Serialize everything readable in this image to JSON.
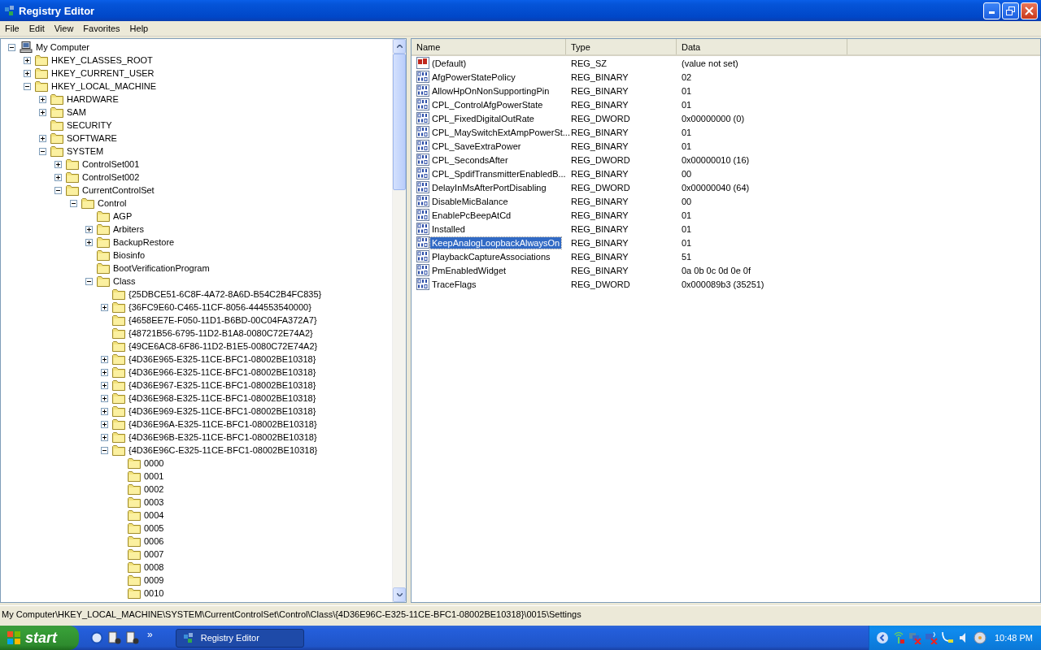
{
  "window": {
    "title": "Registry Editor"
  },
  "menu": [
    "File",
    "Edit",
    "View",
    "Favorites",
    "Help"
  ],
  "tree": [
    {
      "label": "My Computer",
      "kind": "computer",
      "expanded": true,
      "children": [
        {
          "label": "HKEY_CLASSES_ROOT",
          "expanded": false
        },
        {
          "label": "HKEY_CURRENT_USER",
          "expanded": false
        },
        {
          "label": "HKEY_LOCAL_MACHINE",
          "expanded": true,
          "children": [
            {
              "label": "HARDWARE",
              "expanded": false
            },
            {
              "label": "SAM",
              "expanded": false
            },
            {
              "label": "SECURITY"
            },
            {
              "label": "SOFTWARE",
              "expanded": false
            },
            {
              "label": "SYSTEM",
              "expanded": true,
              "children": [
                {
                  "label": "ControlSet001",
                  "expanded": false
                },
                {
                  "label": "ControlSet002",
                  "expanded": false
                },
                {
                  "label": "CurrentControlSet",
                  "expanded": true,
                  "children": [
                    {
                      "label": "Control",
                      "expanded": true,
                      "children": [
                        {
                          "label": "AGP"
                        },
                        {
                          "label": "Arbiters",
                          "expanded": false
                        },
                        {
                          "label": "BackupRestore",
                          "expanded": false
                        },
                        {
                          "label": "Biosinfo"
                        },
                        {
                          "label": "BootVerificationProgram"
                        },
                        {
                          "label": "Class",
                          "expanded": true,
                          "children": [
                            {
                              "label": "{25DBCE51-6C8F-4A72-8A6D-B54C2B4FC835}"
                            },
                            {
                              "label": "{36FC9E60-C465-11CF-8056-444553540000}",
                              "expanded": false
                            },
                            {
                              "label": "{4658EE7E-F050-11D1-B6BD-00C04FA372A7}"
                            },
                            {
                              "label": "{48721B56-6795-11D2-B1A8-0080C72E74A2}"
                            },
                            {
                              "label": "{49CE6AC8-6F86-11D2-B1E5-0080C72E74A2}"
                            },
                            {
                              "label": "{4D36E965-E325-11CE-BFC1-08002BE10318}",
                              "expanded": false
                            },
                            {
                              "label": "{4D36E966-E325-11CE-BFC1-08002BE10318}",
                              "expanded": false
                            },
                            {
                              "label": "{4D36E967-E325-11CE-BFC1-08002BE10318}",
                              "expanded": false
                            },
                            {
                              "label": "{4D36E968-E325-11CE-BFC1-08002BE10318}",
                              "expanded": false
                            },
                            {
                              "label": "{4D36E969-E325-11CE-BFC1-08002BE10318}",
                              "expanded": false
                            },
                            {
                              "label": "{4D36E96A-E325-11CE-BFC1-08002BE10318}",
                              "expanded": false
                            },
                            {
                              "label": "{4D36E96B-E325-11CE-BFC1-08002BE10318}",
                              "expanded": false
                            },
                            {
                              "label": "{4D36E96C-E325-11CE-BFC1-08002BE10318}",
                              "expanded": true,
                              "children": [
                                {
                                  "label": "0000"
                                },
                                {
                                  "label": "0001"
                                },
                                {
                                  "label": "0002"
                                },
                                {
                                  "label": "0003"
                                },
                                {
                                  "label": "0004"
                                },
                                {
                                  "label": "0005"
                                },
                                {
                                  "label": "0006"
                                },
                                {
                                  "label": "0007"
                                },
                                {
                                  "label": "0008"
                                },
                                {
                                  "label": "0009"
                                },
                                {
                                  "label": "0010"
                                }
                              ]
                            }
                          ]
                        }
                      ]
                    }
                  ]
                }
              ]
            }
          ]
        }
      ]
    }
  ],
  "values": {
    "columns": [
      "Name",
      "Type",
      "Data"
    ],
    "rows": [
      {
        "name": "(Default)",
        "type": "REG_SZ",
        "data": "(value not set)",
        "kind": "string",
        "selected": false
      },
      {
        "name": "AfgPowerStatePolicy",
        "type": "REG_BINARY",
        "data": "02",
        "kind": "binary",
        "selected": false
      },
      {
        "name": "AllowHpOnNonSupportingPin",
        "type": "REG_BINARY",
        "data": "01",
        "kind": "binary",
        "selected": false
      },
      {
        "name": "CPL_ControlAfgPowerState",
        "type": "REG_BINARY",
        "data": "01",
        "kind": "binary",
        "selected": false
      },
      {
        "name": "CPL_FixedDigitalOutRate",
        "type": "REG_DWORD",
        "data": "0x00000000 (0)",
        "kind": "binary",
        "selected": false
      },
      {
        "name": "CPL_MaySwitchExtAmpPowerSt...",
        "type": "REG_BINARY",
        "data": "01",
        "kind": "binary",
        "selected": false
      },
      {
        "name": "CPL_SaveExtraPower",
        "type": "REG_BINARY",
        "data": "01",
        "kind": "binary",
        "selected": false
      },
      {
        "name": "CPL_SecondsAfter",
        "type": "REG_DWORD",
        "data": "0x00000010 (16)",
        "kind": "binary",
        "selected": false
      },
      {
        "name": "CPL_SpdifTransmitterEnabledB...",
        "type": "REG_BINARY",
        "data": "00",
        "kind": "binary",
        "selected": false
      },
      {
        "name": "DelayInMsAfterPortDisabling",
        "type": "REG_DWORD",
        "data": "0x00000040 (64)",
        "kind": "binary",
        "selected": false
      },
      {
        "name": "DisableMicBalance",
        "type": "REG_BINARY",
        "data": "00",
        "kind": "binary",
        "selected": false
      },
      {
        "name": "EnablePcBeepAtCd",
        "type": "REG_BINARY",
        "data": "01",
        "kind": "binary",
        "selected": false
      },
      {
        "name": "Installed",
        "type": "REG_BINARY",
        "data": "01",
        "kind": "binary",
        "selected": false
      },
      {
        "name": "KeepAnalogLoopbackAlwaysOn",
        "type": "REG_BINARY",
        "data": "01",
        "kind": "binary",
        "selected": true
      },
      {
        "name": "PlaybackCaptureAssociations",
        "type": "REG_BINARY",
        "data": "51",
        "kind": "binary",
        "selected": false
      },
      {
        "name": "PmEnabledWidget",
        "type": "REG_BINARY",
        "data": "0a 0b 0c 0d 0e 0f",
        "kind": "binary",
        "selected": false
      },
      {
        "name": "TraceFlags",
        "type": "REG_DWORD",
        "data": "0x000089b3 (35251)",
        "kind": "binary",
        "selected": false
      }
    ]
  },
  "status_bar": "My Computer\\HKEY_LOCAL_MACHINE\\SYSTEM\\CurrentControlSet\\Control\\Class\\{4D36E96C-E325-11CE-BFC1-08002BE10318}\\0015\\Settings",
  "taskbar": {
    "start": "start",
    "quick_launch_more": "»",
    "tasks": [
      {
        "label": "Registry Editor",
        "selected": true
      }
    ],
    "clock": "10:48 PM"
  }
}
